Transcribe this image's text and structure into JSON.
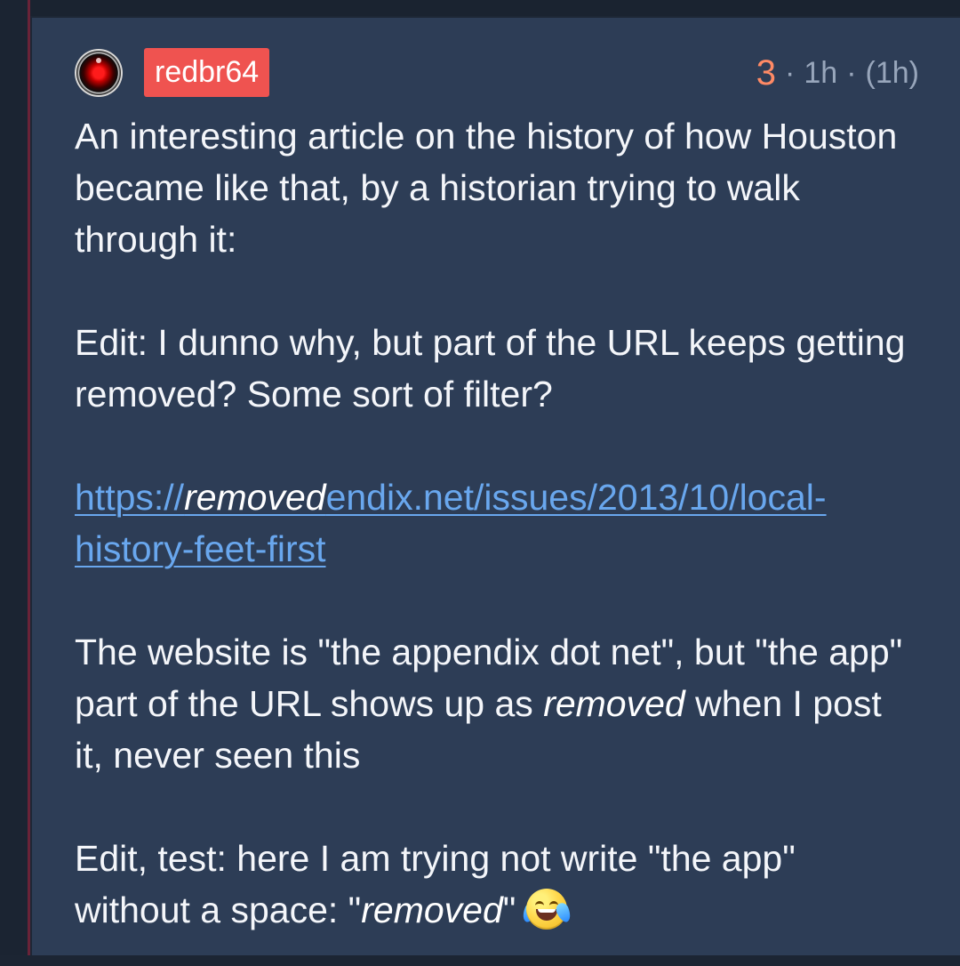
{
  "comment": {
    "username": "redbr64",
    "score": "3",
    "time": "1h",
    "edited_time": "(1h)",
    "avatar_icon": "red-camera-eye-avatar",
    "paragraphs": {
      "intro": "An interesting article on the history of how Houston became like that, by a historian trying to walk through it:",
      "edit_1": "Edit: I dunno why, but part of the URL keeps getting removed? Some sort of filter?",
      "website_a": "The website is \"the appendix dot net\", but \"the app\" part of the URL shows up as ",
      "website_b": " when I post it, never seen this",
      "edit_2_a": "Edit, test: here I am trying not write \"the app\" without a space: \"",
      "edit_2_b": "\""
    },
    "link": {
      "prefix": "https://",
      "removed": "removed",
      "suffix": "endix.net/issues/2013/10/local-history-feet-first"
    },
    "removed_word": "removed",
    "emoji_name": "face-with-tears-of-joy",
    "colors": {
      "background": "#1d2735",
      "card": "#2d3d56",
      "username_badge": "#ef5350",
      "score": "#ff8a65",
      "meta_text": "#98a6bb",
      "body_text": "#f4f6fa",
      "link": "#69a7ee",
      "thread_line": "#6a2338"
    }
  }
}
